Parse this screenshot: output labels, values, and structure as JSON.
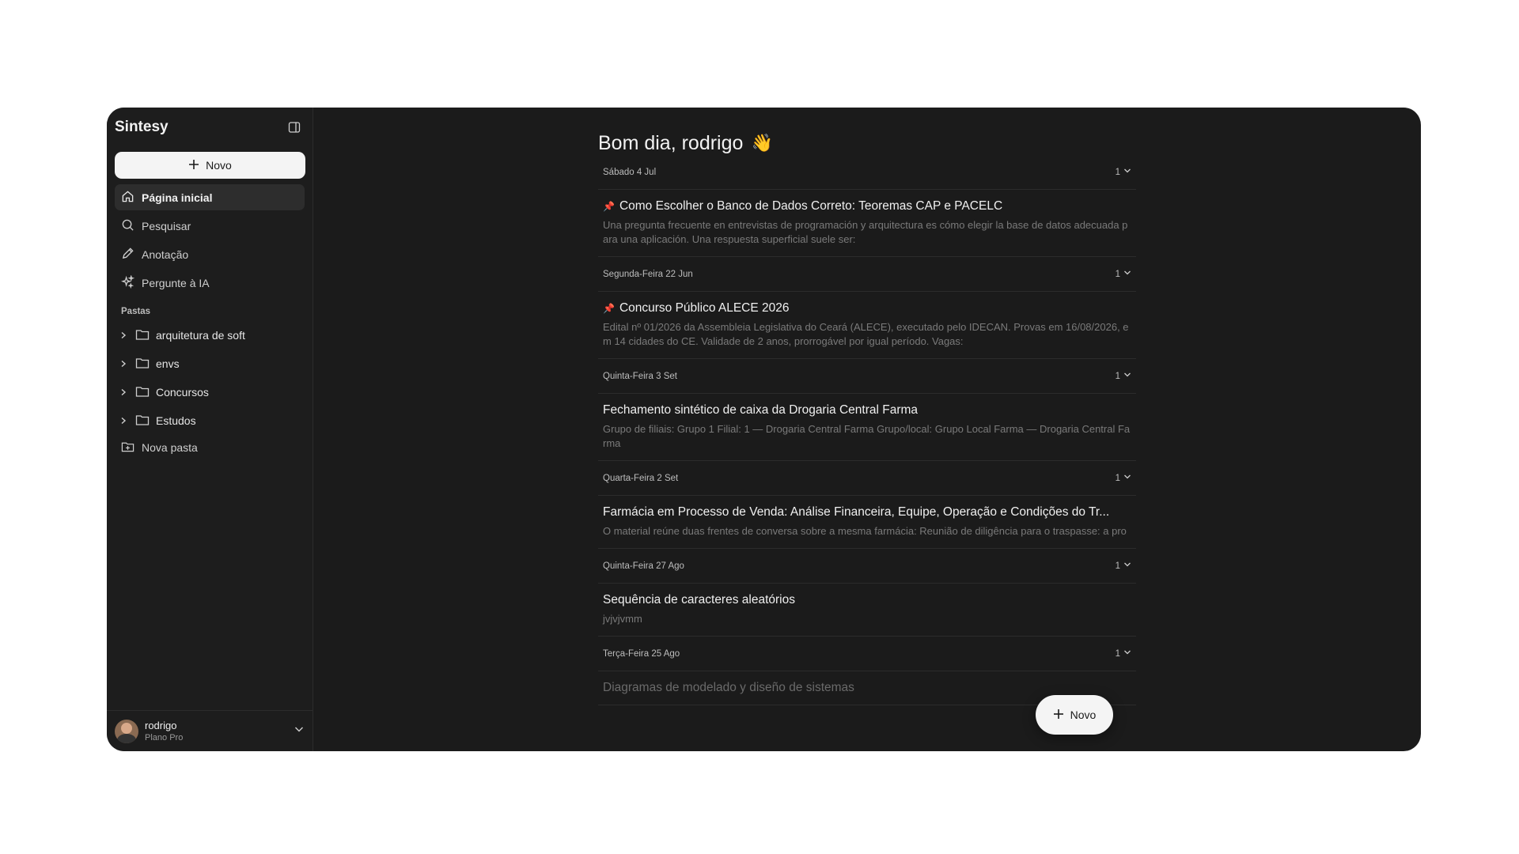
{
  "app": {
    "name": "Sintesy"
  },
  "sidebar": {
    "new_label": "Novo",
    "nav": [
      {
        "label": "Página inicial",
        "icon": "home-icon",
        "active": true
      },
      {
        "label": "Pesquisar",
        "icon": "search-icon"
      },
      {
        "label": "Anotação",
        "icon": "pencil-icon"
      },
      {
        "label": "Pergunte à IA",
        "icon": "sparkles-icon"
      }
    ],
    "folders_label": "Pastas",
    "folders": [
      {
        "label": "arquitetura de soft"
      },
      {
        "label": "envs"
      },
      {
        "label": "Concursos"
      },
      {
        "label": "Estudos"
      }
    ],
    "new_folder_label": "Nova pasta",
    "user": {
      "name": "rodrigo",
      "plan": "Plano Pro"
    }
  },
  "main": {
    "greeting": "Bom dia, rodrigo",
    "greeting_emoji": "👋",
    "groups": [
      {
        "date": "Sábado 4 Jul",
        "count": "1",
        "entry": {
          "pinned": true,
          "title": "Como Escolher o Banco de Dados Correto: Teoremas CAP e PACELC",
          "preview": "Una pregunta frecuente en entrevistas de programación y arquitectura es cómo elegir la base de datos adecuada para una aplicación. Una respuesta superficial suele ser:"
        }
      },
      {
        "date": "Segunda-Feira 22 Jun",
        "count": "1",
        "entry": {
          "pinned": true,
          "title": "Concurso Público ALECE 2026",
          "preview": "Edital nº 01/2026 da Assembleia Legislativa do Ceará (ALECE), executado pelo IDECAN. Provas em 16/08/2026, em 14 cidades do CE. Validade de 2 anos, prorrogável por igual período. Vagas:"
        }
      },
      {
        "date": "Quinta-Feira 3 Set",
        "count": "1",
        "entry": {
          "pinned": false,
          "title": "Fechamento sintético de caixa da Drogaria Central Farma",
          "preview": "Grupo de filiais: Grupo 1 Filial: 1 — Drogaria Central Farma Grupo/local: Grupo Local Farma — Drogaria Central Farma"
        }
      },
      {
        "date": "Quarta-Feira 2 Set",
        "count": "1",
        "entry": {
          "pinned": false,
          "title": "Farmácia em Processo de Venda: Análise Financeira, Equipe, Operação e Condições do Tr...",
          "preview": "O material reúne duas frentes de conversa sobre a mesma farmácia: Reunião de diligência para o traspasse: a pro"
        }
      },
      {
        "date": "Quinta-Feira 27 Ago",
        "count": "1",
        "entry": {
          "pinned": false,
          "title": "Sequência de caracteres aleatórios",
          "preview": "jvjvjvmm"
        }
      },
      {
        "date": "Terça-Feira 25 Ago",
        "count": "1",
        "entry": {
          "pinned": false,
          "title": "Diagramas de modelado y diseño de sistemas",
          "preview": ""
        }
      }
    ],
    "fab_label": "Novo"
  }
}
